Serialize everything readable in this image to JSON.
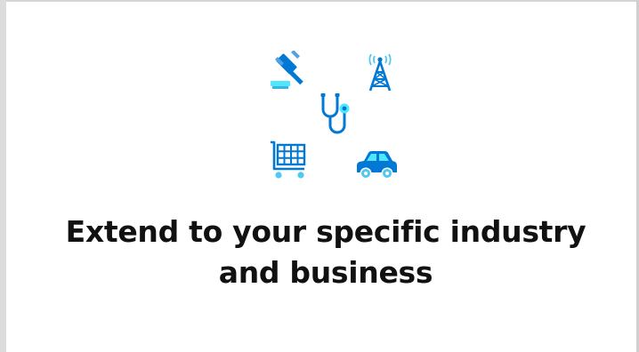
{
  "headline": "Extend to your specific industry and business",
  "icons": [
    "gavel-icon",
    "cell-tower-icon",
    "stethoscope-icon",
    "shopping-cart-icon",
    "car-icon"
  ],
  "colors": {
    "primary_blue": "#0078d4",
    "light_blue": "#50e6ff",
    "text": "#111111",
    "background": "#ffffff"
  }
}
